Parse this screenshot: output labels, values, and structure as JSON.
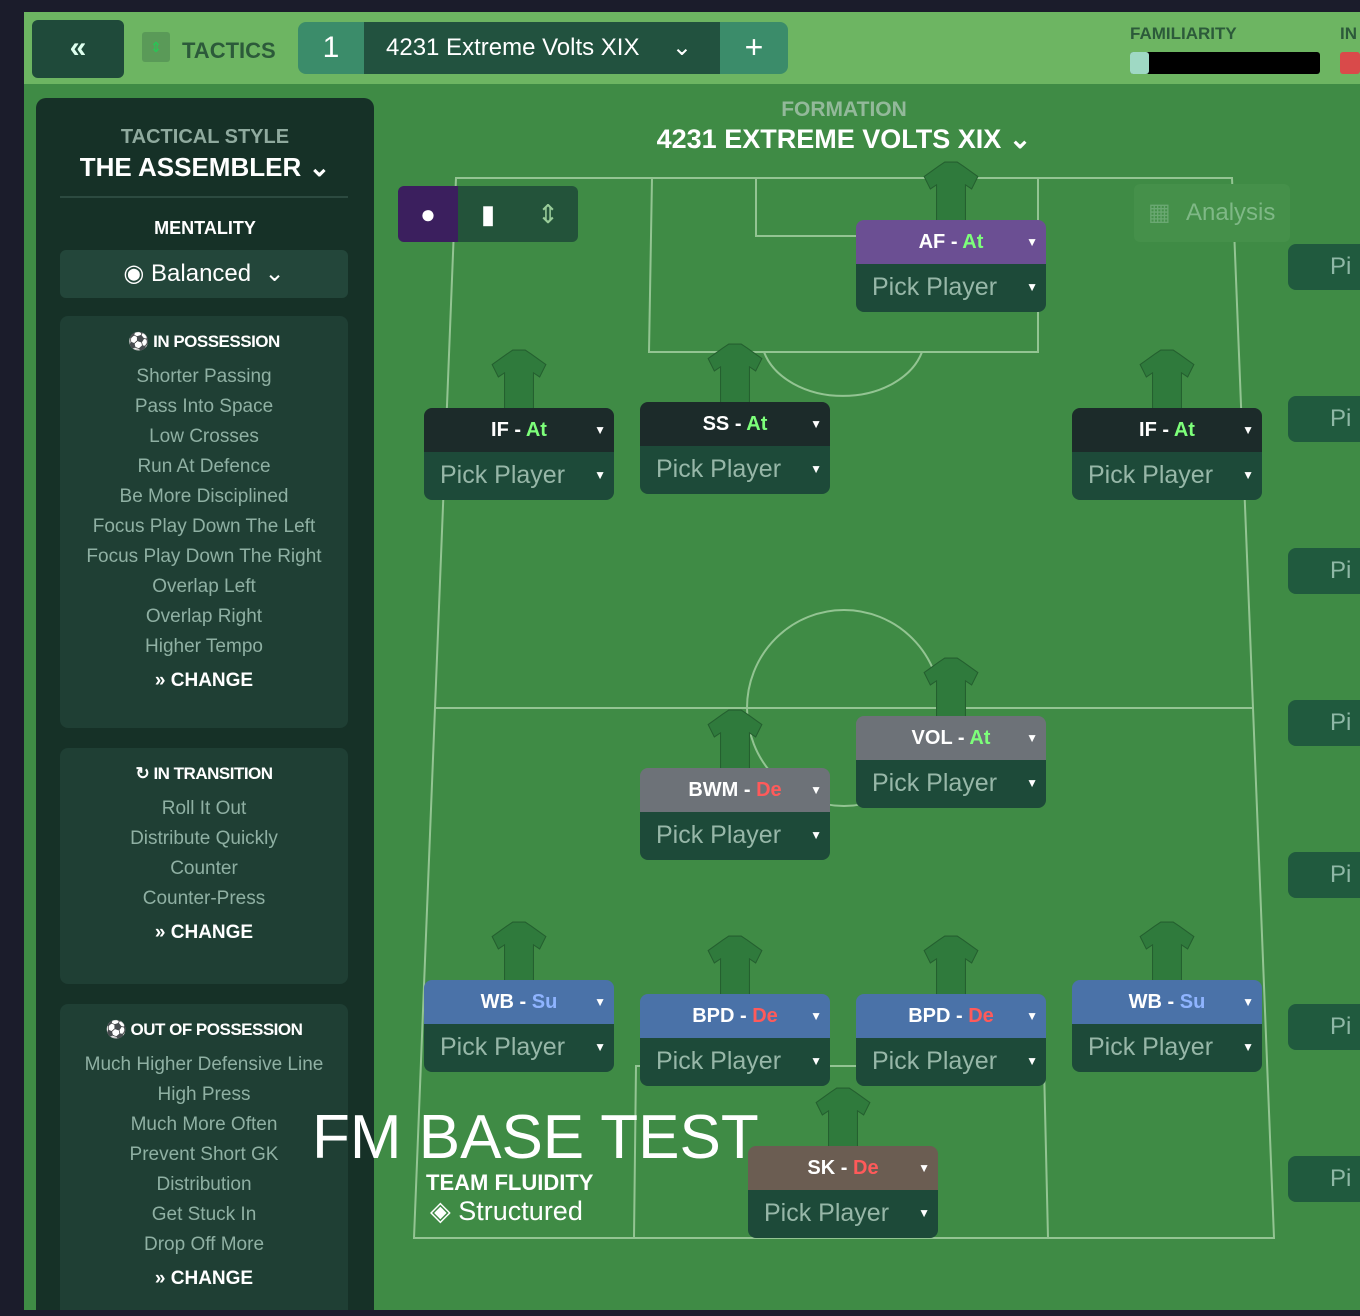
{
  "topbar": {
    "back_icon": "double-chevron-left-icon",
    "tactics_label": "TACTICS",
    "slot": "1",
    "tactic_name": "4231 Extreme Volts  XIX",
    "add": "+",
    "familiarity_label": "FAMILIARITY",
    "familiarity_level": 0.1,
    "in_label": "IN"
  },
  "left": {
    "style_label": "TACTICAL STYLE",
    "style_value": "THE ASSEMBLER",
    "mentality_label": "MENTALITY",
    "mentality_value": "Balanced",
    "in_possession": {
      "title": "IN POSSESSION",
      "items": [
        "Shorter Passing",
        "Pass Into Space",
        "Low Crosses",
        "Run At Defence",
        "Be More Disciplined",
        "Focus Play Down The Left",
        "Focus Play Down The Right",
        "Overlap Left",
        "Overlap Right",
        "Higher Tempo"
      ],
      "change": "CHANGE"
    },
    "in_transition": {
      "title": "IN TRANSITION",
      "items": [
        "Roll It Out",
        "Distribute Quickly",
        "Counter",
        "Counter-Press"
      ],
      "change": "CHANGE"
    },
    "out_of_possession": {
      "title": "OUT OF POSSESSION",
      "items": [
        "Much Higher Defensive Line",
        "High Press",
        "Much More Often",
        "Prevent Short GK",
        "Distribution",
        "Get Stuck In",
        "Drop Off More"
      ],
      "change": "CHANGE"
    }
  },
  "formation": {
    "label": "FORMATION",
    "name": "4231 EXTREME VOLTS  XIX"
  },
  "analysis": "Analysis",
  "colors": {
    "attack": "#7dff7a",
    "support": "#8fb4ff",
    "defend": "#ff5a5a",
    "header_att": "#6b4f93",
    "header_dark": "#1c2b2a",
    "header_dm": "#6d7278",
    "header_def": "#4a72a8",
    "header_gk": "#6b5d52"
  },
  "players": [
    {
      "role": "AF",
      "duty": "At",
      "pick": "Pick Player"
    },
    {
      "role": "IF",
      "duty": "At",
      "pick": "Pick Player"
    },
    {
      "role": "SS",
      "duty": "At",
      "pick": "Pick Player"
    },
    {
      "role": "IF",
      "duty": "At",
      "pick": "Pick Player"
    },
    {
      "role": "VOL",
      "duty": "At",
      "pick": "Pick Player"
    },
    {
      "role": "BWM",
      "duty": "De",
      "pick": "Pick Player"
    },
    {
      "role": "WB",
      "duty": "Su",
      "pick": "Pick Player"
    },
    {
      "role": "BPD",
      "duty": "De",
      "pick": "Pick Player"
    },
    {
      "role": "BPD",
      "duty": "De",
      "pick": "Pick Player"
    },
    {
      "role": "WB",
      "duty": "Su",
      "pick": "Pick Player"
    },
    {
      "role": "SK",
      "duty": "De",
      "pick": "Pick Player"
    }
  ],
  "right_buttons": [
    "Pi",
    "Pi",
    "Pi",
    "Pi",
    "Pi",
    "Pi",
    "Pi"
  ],
  "watermark": "FM BASE TEST",
  "fluidity": {
    "label": "TEAM FLUIDITY",
    "value": "Structured"
  }
}
